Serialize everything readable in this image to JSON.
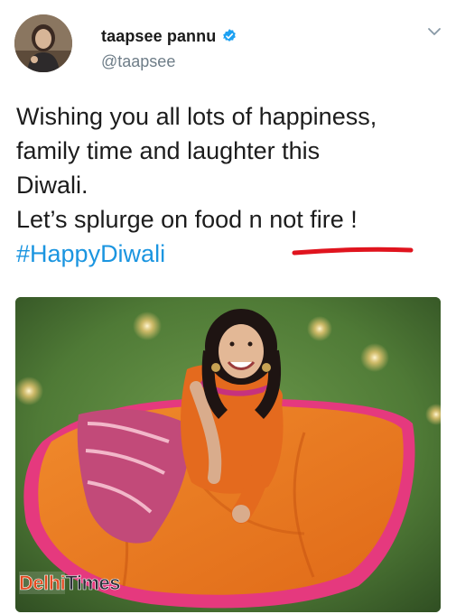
{
  "tweet": {
    "display_name": "taapsee pannu",
    "handle": "@taapsee",
    "text_lines": [
      "Wishing you all lots of happiness,",
      "family time and laughter this",
      "Diwali.",
      "Let’s splurge on food n not fire !"
    ],
    "hashtag": "#HappyDiwali"
  },
  "media": {
    "watermark_part1": "Delhi",
    "watermark_part2": "Times"
  },
  "icons": {
    "verified": "verified-badge-icon",
    "menu": "chevron-down-icon"
  },
  "colors": {
    "name": "#1b1b1b",
    "handle": "#6e7d88",
    "text": "#1c1c1c",
    "hashtag": "#1b95e0",
    "verified": "#1da1f2",
    "underline": "#e0141e"
  }
}
